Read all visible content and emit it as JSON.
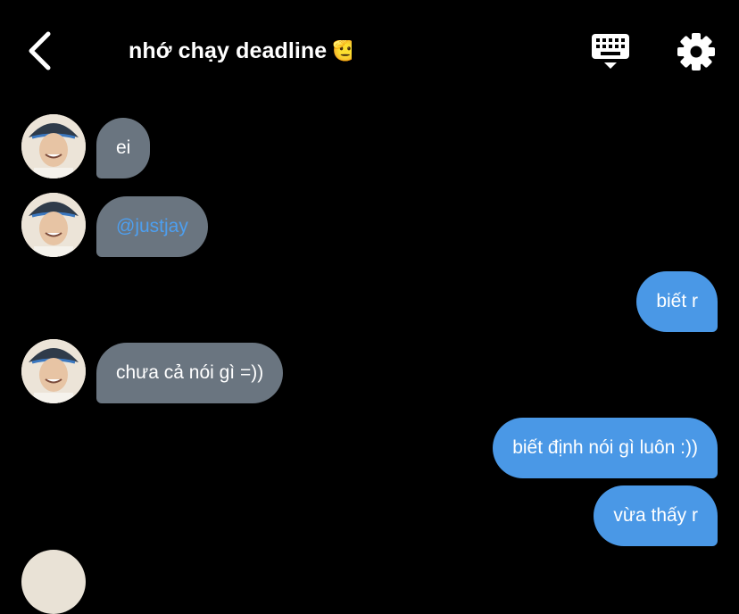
{
  "header": {
    "title": "nhớ chạy deadline",
    "title_emoji": "🫡",
    "back_icon": "chevron-left-icon",
    "keyboard_icon": "keyboard-icon",
    "settings_icon": "gear-icon"
  },
  "colors": {
    "background": "#000000",
    "incoming_bubble": "#6a7580",
    "outgoing_bubble": "#4a98e6",
    "mention": "#4d9ff0"
  },
  "messages": [
    {
      "direction": "incoming",
      "text": "ei"
    },
    {
      "direction": "incoming",
      "text": "@justjay"
    },
    {
      "direction": "outgoing",
      "text": "biết r"
    },
    {
      "direction": "incoming",
      "text": "chưa cả nói gì =))"
    },
    {
      "direction": "outgoing",
      "text": "biết định nói gì luôn :))"
    },
    {
      "direction": "outgoing",
      "text": "vừa thấy r"
    }
  ]
}
